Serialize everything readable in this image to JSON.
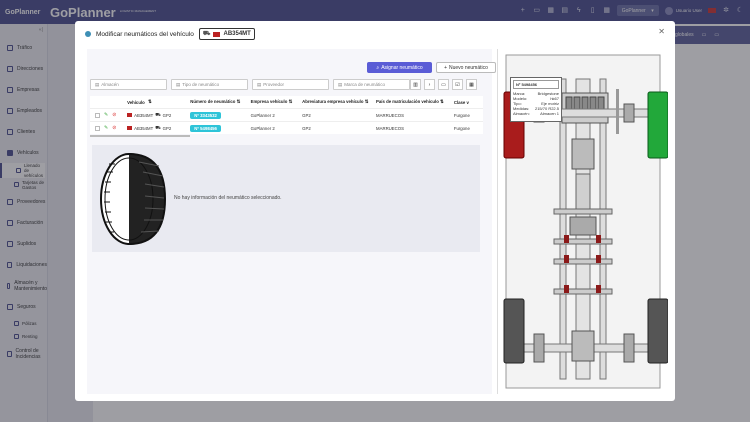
{
  "topbar": {
    "brand": "GoPlanner",
    "logo": "GoPlanner",
    "logo_sub": "LOGISTIC MANAGEMENT",
    "company": "GoPlanner",
    "user": "Usuario User"
  },
  "sidebar": {
    "items": [
      {
        "label": "Tráfico"
      },
      {
        "label": "Direcciones"
      },
      {
        "label": "Empresas"
      },
      {
        "label": "Empleados"
      },
      {
        "label": "Clientes"
      },
      {
        "label": "Vehículos"
      }
    ],
    "sub_vehiculos": [
      {
        "label": "Llenado de vehículos"
      },
      {
        "label": "Tarjetas de Gastos"
      }
    ],
    "items2": [
      {
        "label": "Proveedores"
      },
      {
        "label": "Facturación"
      },
      {
        "label": "Suplidos"
      },
      {
        "label": "Liquidaciones"
      },
      {
        "label": "Almacén y Mantenimiento"
      },
      {
        "label": "Seguros"
      }
    ],
    "sub_seguros": [
      {
        "label": "Pólizas"
      },
      {
        "label": "Renting"
      }
    ],
    "items3": [
      {
        "label": "Control de Incidencias"
      }
    ]
  },
  "background": {
    "tab": "globales"
  },
  "modal": {
    "title": "Modificar neumáticos del vehículo",
    "plate": "AB354MT",
    "assign_button": "Asignar neumático",
    "new_button": "Nuevo neumático",
    "filters": [
      "Almacén",
      "Tipo de neumático",
      "Proveedor",
      "Marca de neumático"
    ],
    "headers": [
      "Vehículo",
      "Número de neumático",
      "Empresa vehículo",
      "Abreviatura empresa vehículo",
      "País de matriculación vehículo",
      "Clase v"
    ],
    "rows": [
      {
        "vehicle": "AB354MT",
        "sub": "GP2",
        "tire": "Nº 3343532",
        "company": "GoPlanner 2",
        "abbr": "GP2",
        "country": "MARRUECOS",
        "class": "Furgone"
      },
      {
        "vehicle": "AB354MT",
        "sub": "GP2",
        "tire": "Nº 5498456",
        "company": "GoPlanner 2",
        "abbr": "GP2",
        "country": "MARRUECOS",
        "class": "Furgone"
      }
    ],
    "no_info": "No hay información del neumático seleccionado.",
    "tooltip": {
      "title": "Nº 5498456",
      "fields": [
        {
          "k": "Marca:",
          "v": "Bridgestone"
        },
        {
          "k": "Modelo:",
          "v": "hk67"
        },
        {
          "k": "Tipo:",
          "v": "Eje motriz"
        },
        {
          "k": "Medidas:",
          "v": "215/70 R22.5"
        },
        {
          "k": "Almacén:",
          "v": "Almacen 1"
        }
      ]
    }
  }
}
